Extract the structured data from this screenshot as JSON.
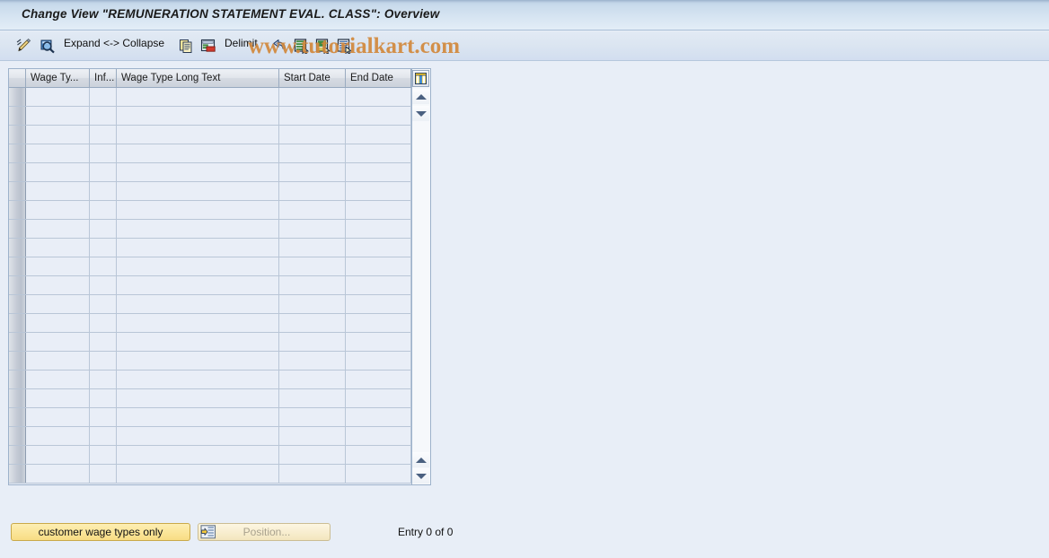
{
  "window": {
    "title": "Change View \"REMUNERATION STATEMENT EVAL. CLASS\": Overview"
  },
  "watermark": {
    "text": "www.tutorialkart.com",
    "color": "#d2883b"
  },
  "toolbar": {
    "items": [
      {
        "name": "change-display-icon",
        "icon": "pencil-edit-icon",
        "label": ""
      },
      {
        "name": "display-details-icon",
        "icon": "magnifier-icon",
        "label": ""
      },
      {
        "name": "expand-collapse-button",
        "icon": "",
        "label": "Expand <-> Collapse"
      },
      {
        "name": "copy-as-icon",
        "icon": "copy-documents-icon",
        "label": ""
      },
      {
        "name": "delete-row-icon",
        "icon": "delete-row-icon",
        "label": ""
      },
      {
        "name": "delimit-button",
        "icon": "",
        "label": "Delimit"
      },
      {
        "name": "undo-icon",
        "icon": "undo-arrow-icon",
        "label": ""
      },
      {
        "name": "select-all-icon",
        "icon": "select-block-icon",
        "label": ""
      },
      {
        "name": "deselect-all-icon",
        "icon": "deselect-block-icon",
        "label": ""
      },
      {
        "name": "select-detail-icon",
        "icon": "select-lines-icon",
        "label": ""
      }
    ],
    "expand_collapse_label": "Expand <-> Collapse",
    "delimit_label": "Delimit"
  },
  "table": {
    "columns": [
      {
        "key": "selector",
        "label": "",
        "width": 19
      },
      {
        "key": "wage_type",
        "label": "Wage Ty...",
        "width": 71
      },
      {
        "key": "info",
        "label": "Inf...",
        "width": 30
      },
      {
        "key": "long_text",
        "label": "Wage Type Long Text",
        "width": 181
      },
      {
        "key": "start_date",
        "label": "Start Date",
        "width": 74
      },
      {
        "key": "end_date",
        "label": "End Date",
        "width": 73
      }
    ],
    "rows": [],
    "row_count_empty": 21,
    "column_config_icon": "column-settings-icon",
    "scroll_up_icon": "scroll-up-arrow-icon",
    "scroll_down_icon": "scroll-down-arrow-icon"
  },
  "footer": {
    "customer_wage_types_button": "customer wage types only",
    "position_button": "Position...",
    "position_icon": "position-goto-icon",
    "entry_status": "Entry 0 of 0"
  }
}
